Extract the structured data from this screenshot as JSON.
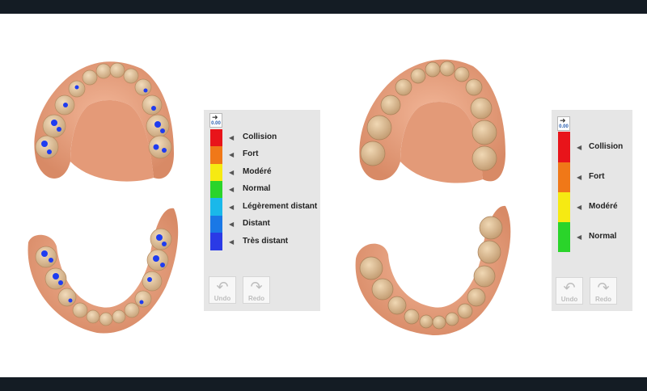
{
  "left_panel": {
    "reset_value": "0.00",
    "legend": [
      {
        "label": "Collision",
        "color": "#e8141a"
      },
      {
        "label": "Fort",
        "color": "#f07818"
      },
      {
        "label": "Modéré",
        "color": "#f6ea12"
      },
      {
        "label": "Normal",
        "color": "#2ad42a"
      },
      {
        "label": "Légèrement distant",
        "color": "#1ab8ea"
      },
      {
        "label": "Distant",
        "color": "#1a78e6"
      },
      {
        "label": "Très distant",
        "color": "#2a3ae6"
      }
    ],
    "undo_label": "Undo",
    "redo_label": "Redo"
  },
  "right_panel": {
    "reset_value": "0.00",
    "legend": [
      {
        "label": "Collision",
        "color": "#e8141a"
      },
      {
        "label": "Fort",
        "color": "#f07818"
      },
      {
        "label": "Modéré",
        "color": "#f6ea12"
      },
      {
        "label": "Normal",
        "color": "#2ad42a"
      }
    ],
    "undo_label": "Undo",
    "redo_label": "Redo"
  },
  "colors": {
    "gum": "#e8a07e",
    "tooth": "#e2c8a2",
    "contact": "#1f3cf0",
    "frame": "#141c24"
  },
  "icons": [
    "reset-arrow-icon",
    "caret-left-icon",
    "undo-arrow-icon",
    "redo-arrow-icon"
  ]
}
